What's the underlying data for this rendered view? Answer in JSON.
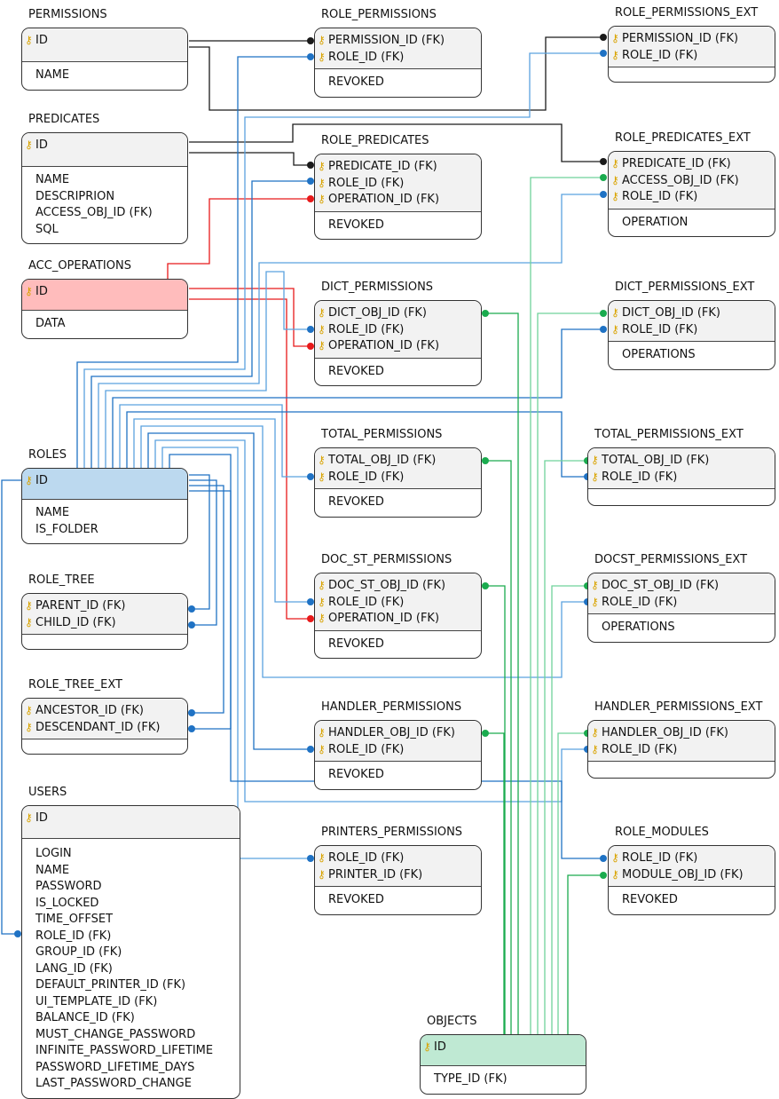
{
  "colors": {
    "line_black": "#1a1a1a",
    "line_blue": "#1f72c4",
    "line_blue_light": "#5aa2df",
    "line_red": "#e8191a",
    "line_green": "#1aab4e",
    "line_green_light": "#6fd29a",
    "key_icon": "#d9a300",
    "acc_operations_header": "#ffbcbc",
    "roles_header": "#bcd9ef",
    "objects_header": "#bfe9d3",
    "default_header": "#f2f2f2"
  },
  "entities": [
    {
      "id": "permissions",
      "title": "PERMISSIONS",
      "keys": [
        "ID"
      ],
      "attrs": [
        "NAME"
      ]
    },
    {
      "id": "role_permissions",
      "title": "ROLE_PERMISSIONS",
      "keys": [
        "PERMISSION_ID (FK)",
        "ROLE_ID (FK)"
      ],
      "attrs": [
        "REVOKED"
      ]
    },
    {
      "id": "role_permissions_ext",
      "title": "ROLE_PERMISSIONS_EXT",
      "keys": [
        "PERMISSION_ID (FK)",
        "ROLE_ID (FK)"
      ],
      "attrs": []
    },
    {
      "id": "predicates",
      "title": "PREDICATES",
      "keys": [
        "ID"
      ],
      "attrs": [
        "NAME",
        "DESCRIPRION",
        "ACCESS_OBJ_ID (FK)",
        "SQL"
      ]
    },
    {
      "id": "role_predicates",
      "title": "ROLE_PREDICATES",
      "keys": [
        "PREDICATE_ID (FK)",
        "ROLE_ID (FK)",
        "OPERATION_ID (FK)"
      ],
      "attrs": [
        "REVOKED"
      ]
    },
    {
      "id": "role_predicates_ext",
      "title": "ROLE_PREDICATES_EXT",
      "keys": [
        "PREDICATE_ID (FK)",
        "ACCESS_OBJ_ID (FK)",
        "ROLE_ID (FK)"
      ],
      "attrs": [
        "OPERATION"
      ]
    },
    {
      "id": "acc_operations",
      "title": "ACC_OPERATIONS",
      "keys": [
        "ID"
      ],
      "attrs": [
        "DATA"
      ]
    },
    {
      "id": "dict_permissions",
      "title": "DICT_PERMISSIONS",
      "keys": [
        "DICT_OBJ_ID (FK)",
        "ROLE_ID (FK)",
        "OPERATION_ID (FK)"
      ],
      "attrs": [
        "REVOKED"
      ]
    },
    {
      "id": "dict_permissions_ext",
      "title": "DICT_PERMISSIONS_EXT",
      "keys": [
        "DICT_OBJ_ID (FK)",
        "ROLE_ID (FK)"
      ],
      "attrs": [
        "OPERATIONS"
      ]
    },
    {
      "id": "roles",
      "title": "ROLES",
      "keys": [
        "ID"
      ],
      "attrs": [
        "NAME",
        "IS_FOLDER"
      ]
    },
    {
      "id": "total_permissions",
      "title": "TOTAL_PERMISSIONS",
      "keys": [
        "TOTAL_OBJ_ID (FK)",
        "ROLE_ID (FK)"
      ],
      "attrs": [
        "REVOKED"
      ]
    },
    {
      "id": "total_permissions_ext",
      "title": "TOTAL_PERMISSIONS_EXT",
      "keys": [
        "TOTAL_OBJ_ID (FK)",
        "ROLE_ID (FK)"
      ],
      "attrs": []
    },
    {
      "id": "role_tree",
      "title": "ROLE_TREE",
      "keys": [
        "PARENT_ID (FK)",
        "CHILD_ID (FK)"
      ],
      "attrs": []
    },
    {
      "id": "doc_st_permissions",
      "title": "DOC_ST_PERMISSIONS",
      "keys": [
        "DOC_ST_OBJ_ID (FK)",
        "ROLE_ID (FK)",
        "OPERATION_ID (FK)"
      ],
      "attrs": [
        "REVOKED"
      ]
    },
    {
      "id": "docst_permissions_ext",
      "title": "DOCST_PERMISSIONS_EXT",
      "keys": [
        "DOC_ST_OBJ_ID (FK)",
        "ROLE_ID (FK)"
      ],
      "attrs": [
        "OPERATIONS"
      ]
    },
    {
      "id": "role_tree_ext",
      "title": "ROLE_TREE_EXT",
      "keys": [
        "ANCESTOR_ID (FK)",
        "DESCENDANT_ID (FK)"
      ],
      "attrs": []
    },
    {
      "id": "handler_permissions",
      "title": "HANDLER_PERMISSIONS",
      "keys": [
        "HANDLER_OBJ_ID (FK)",
        "ROLE_ID (FK)"
      ],
      "attrs": [
        "REVOKED"
      ]
    },
    {
      "id": "handler_permissions_ext",
      "title": "HANDLER_PERMISSIONS_EXT",
      "keys": [
        "HANDLER_OBJ_ID (FK)",
        "ROLE_ID (FK)"
      ],
      "attrs": []
    },
    {
      "id": "users",
      "title": "USERS",
      "keys": [
        "ID"
      ],
      "attrs": [
        "LOGIN",
        "NAME",
        "PASSWORD",
        "IS_LOCKED",
        "TIME_OFFSET",
        "ROLE_ID (FK)",
        "GROUP_ID (FK)",
        "LANG_ID (FK)",
        "DEFAULT_PRINTER_ID (FK)",
        "UI_TEMPLATE_ID (FK)",
        "BALANCE_ID (FK)",
        "MUST_CHANGE_PASSWORD",
        "INFINITE_PASSWORD_LIFETIME",
        "PASSWORD_LIFETIME_DAYS",
        "LAST_PASSWORD_CHANGE"
      ]
    },
    {
      "id": "printers_permissions",
      "title": "PRINTERS_PERMISSIONS",
      "keys": [
        "ROLE_ID (FK)",
        "PRINTER_ID (FK)"
      ],
      "attrs": [
        "REVOKED"
      ]
    },
    {
      "id": "role_modules",
      "title": "ROLE_MODULES",
      "keys": [
        "ROLE_ID (FK)",
        "MODULE_OBJ_ID (FK)"
      ],
      "attrs": [
        "REVOKED"
      ]
    },
    {
      "id": "objects",
      "title": "OBJECTS",
      "keys": [
        "ID"
      ],
      "attrs": [
        "TYPE_ID (FK)"
      ]
    }
  ],
  "icons": {
    "key": "key-icon"
  }
}
